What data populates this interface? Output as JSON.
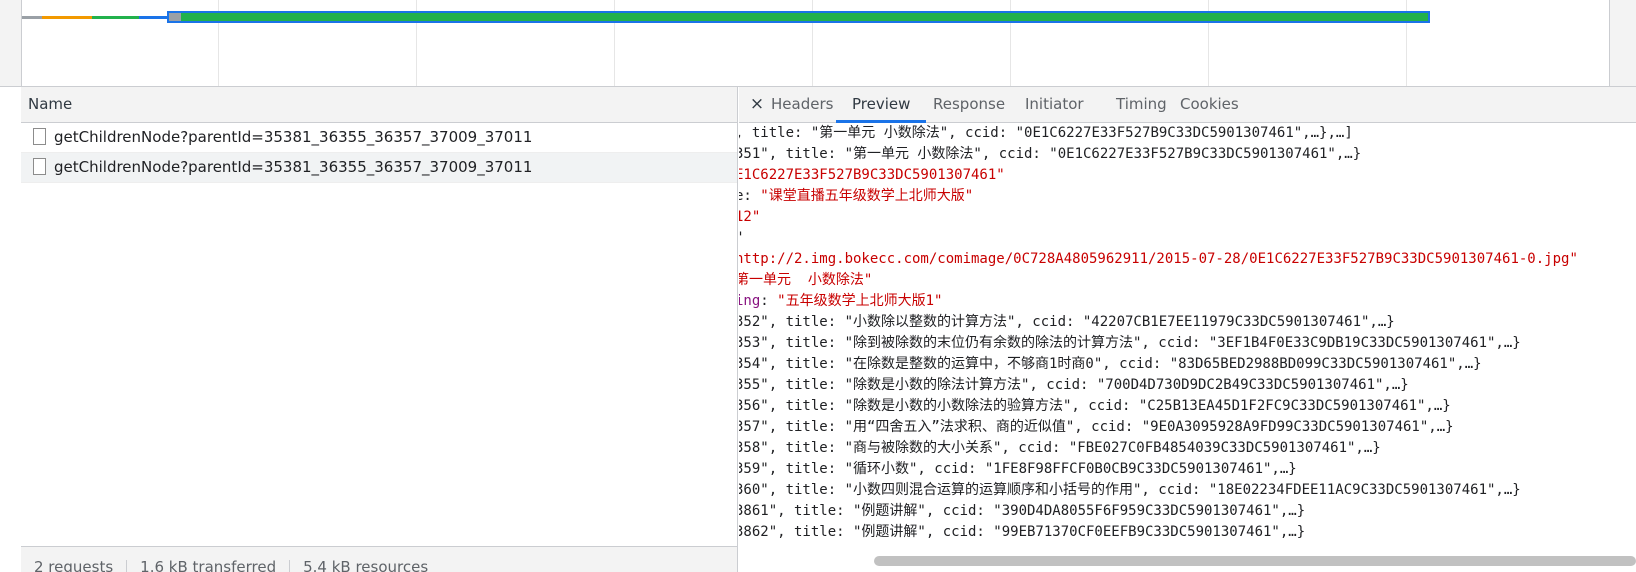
{
  "request_list": {
    "header": "Name",
    "rows": [
      {
        "name": "getChildrenNode?parentId=35381_36355_36357_37009_37011"
      },
      {
        "name": "getChildrenNode?parentId=35381_36355_36357_37009_37011"
      }
    ],
    "status": {
      "requests": "2 requests",
      "transferred": "1.6 kB transferred",
      "resources": "5.4 kB resources"
    }
  },
  "detail": {
    "close_glyph": "×",
    "tabs": [
      "Headers",
      "Preview",
      "Response",
      "Initiator",
      "Timing",
      "Cookies"
    ],
    "active_tab": "Preview",
    "preview_lines": [
      [
        {
          "t": ", title: ",
          "c": "p"
        },
        {
          "t": "\"第一单元 小数除法\"",
          "c": "p"
        },
        {
          "t": ", ccid: ",
          "c": "p"
        },
        {
          "t": "\"0E1C6227E33F527B9C33DC5901307461\"",
          "c": "p"
        },
        {
          "t": ",…},…]",
          "c": "p"
        }
      ],
      [
        {
          "t": "351\", title: \"第一单元 小数除法\", ccid: \"0E1C6227E33F527B9C33DC5901307461\",…}",
          "c": "p"
        }
      ],
      [
        {
          "t": "E1C6227E33F527B9C33DC5901307461\"",
          "c": "s"
        }
      ],
      [
        {
          "t": "e: ",
          "c": "p"
        },
        {
          "t": "\"课堂直播五年级数学上北师大版\"",
          "c": "s"
        }
      ],
      [
        {
          "t": "12\"",
          "c": "s"
        }
      ],
      [
        {
          "t": "\"",
          "c": "p"
        }
      ],
      [
        {
          "t": "http://2.img.bokecc.com/comimage/0C728A4805962911/2015-07-28/0E1C6227E33F527B9C33DC5901307461-0.jpg\"",
          "c": "s"
        }
      ],
      [
        {
          "t": "第一单元  小数除法\"",
          "c": "s"
        }
      ],
      [
        {
          "t": "ing",
          "c": "k"
        },
        {
          "t": ": ",
          "c": "p"
        },
        {
          "t": "\"五年级数学上北师大版1\"",
          "c": "s"
        }
      ],
      [
        {
          "t": "352\", title: \"小数除以整数的计算方法\", ccid: \"42207CB1E7EE11979C33DC5901307461\",…}",
          "c": "p"
        }
      ],
      [
        {
          "t": "353\", title: \"除到被除数的末位仍有余数的除法的计算方法\", ccid: \"3EF1B4F0E33C9DB19C33DC5901307461\",…}",
          "c": "p"
        }
      ],
      [
        {
          "t": "354\", title: \"在除数是整数的运算中，不够商1时商0\", ccid: \"83D65BED2988BD099C33DC5901307461\",…}",
          "c": "p"
        }
      ],
      [
        {
          "t": "355\", title: \"除数是小数的除法计算方法\", ccid: \"700D4D730D9DC2B49C33DC5901307461\",…}",
          "c": "p"
        }
      ],
      [
        {
          "t": "356\", title: \"除数是小数的小数除法的验算方法\", ccid: \"C25B13EA45D1F2FC9C33DC5901307461\",…}",
          "c": "p"
        }
      ],
      [
        {
          "t": "357\", title: \"用“四舍五入”法求积、商的近似值\", ccid: \"9E0A3095928A9FD99C33DC5901307461\",…}",
          "c": "p"
        }
      ],
      [
        {
          "t": "358\", title: \"商与被除数的大小关系\", ccid: \"FBE027C0FB4854039C33DC5901307461\",…}",
          "c": "p"
        }
      ],
      [
        {
          "t": "359\", title: \"循环小数\", ccid: \"1FE8F98FFCF0B0CB9C33DC5901307461\",…}",
          "c": "p"
        }
      ],
      [
        {
          "t": "360\", title: \"小数四则混合运算的运算顺序和小括号的作用\", ccid: \"18E02234FDEE11AC9C33DC5901307461\",…}",
          "c": "p"
        }
      ],
      [
        {
          "t": "3861\", title: \"例题讲解\", ccid: \"390D4DA8055F6F959C33DC5901307461\",…}",
          "c": "p"
        }
      ],
      [
        {
          "t": "3862\", title: \"例题讲解\", ccid: \"99EB71370CF0EEFB9C33DC5901307461\",…}",
          "c": "p"
        }
      ]
    ]
  },
  "colors": {
    "accent": "#1a73e8",
    "string": "#c80000",
    "key": "#881280",
    "timeline_bar": "#22b14c"
  }
}
